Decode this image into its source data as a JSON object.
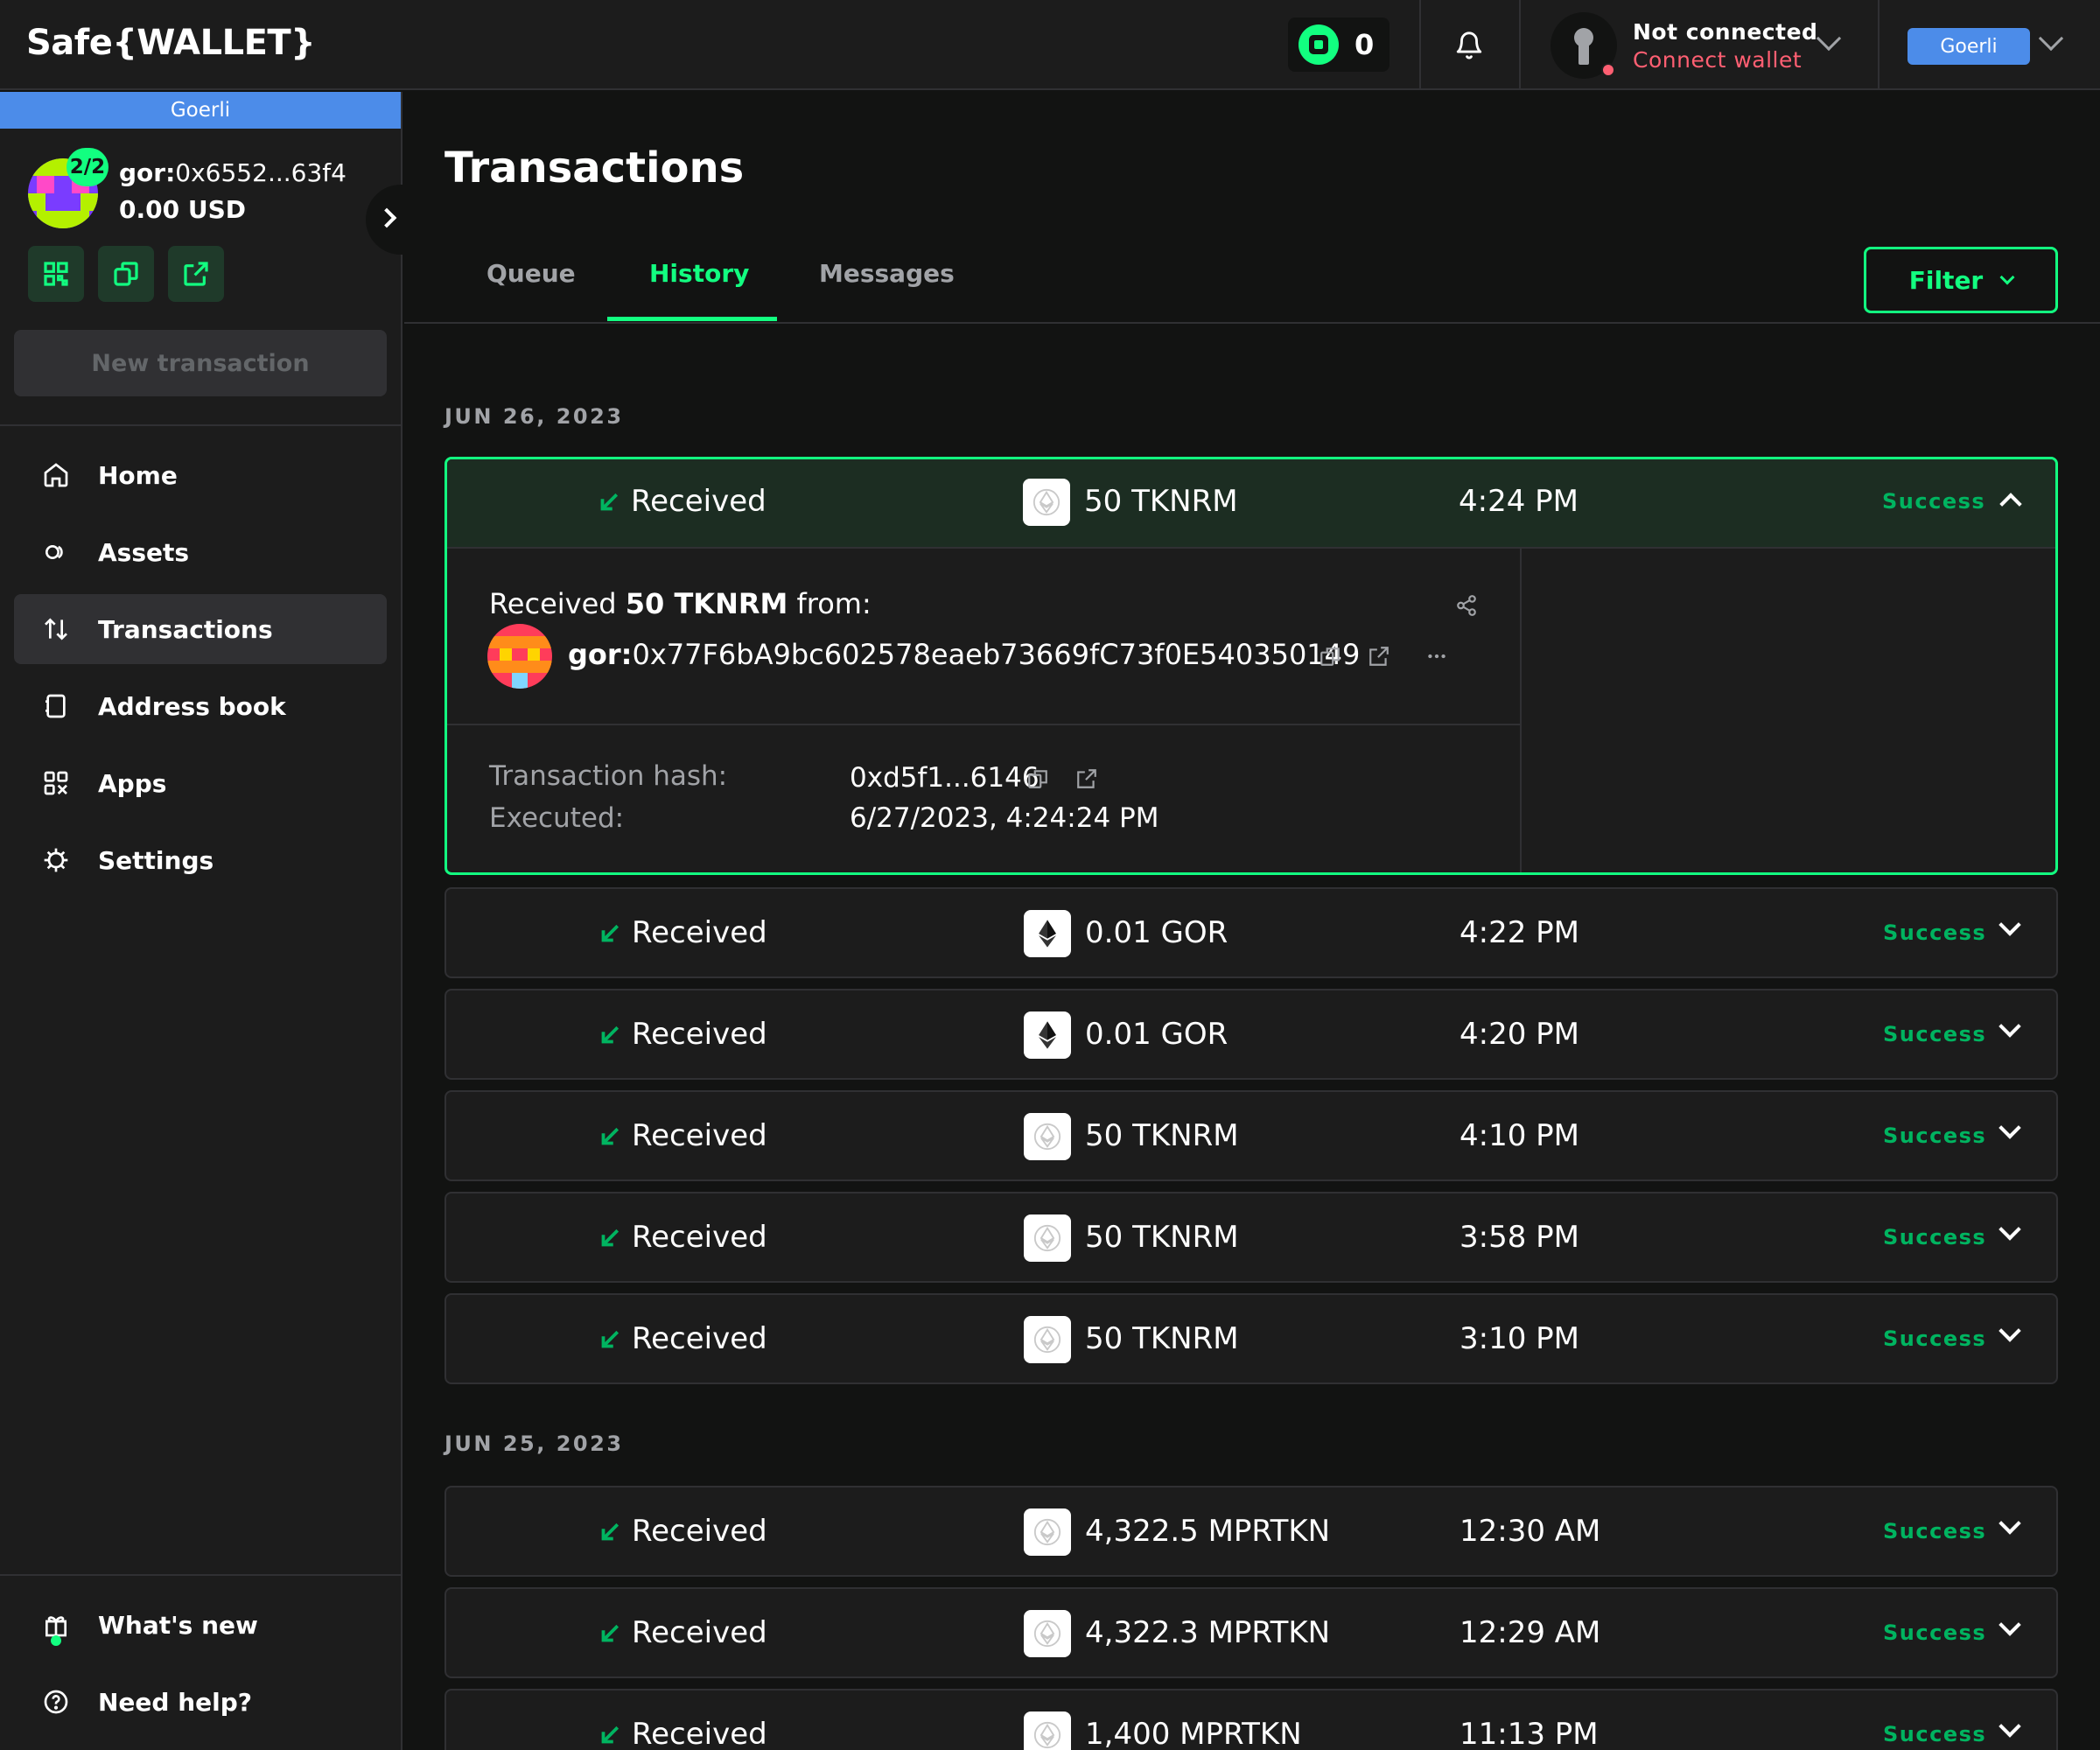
{
  "header": {
    "logo": "Safe{WALLET}",
    "pending_count": "0",
    "wallet_status": "Not connected",
    "connect_label": "Connect wallet",
    "network": "Goerli"
  },
  "sidebar": {
    "network_bar": "Goerli",
    "threshold": "2/2",
    "address_prefix": "gor:",
    "address": "0x6552...63f4",
    "balance": "0.00 USD",
    "new_transaction": "New transaction",
    "nav": [
      {
        "label": "Home",
        "icon": "home-icon"
      },
      {
        "label": "Assets",
        "icon": "assets-icon"
      },
      {
        "label": "Transactions",
        "icon": "transactions-icon"
      },
      {
        "label": "Address book",
        "icon": "address-book-icon"
      },
      {
        "label": "Apps",
        "icon": "apps-icon"
      },
      {
        "label": "Settings",
        "icon": "settings-icon"
      }
    ],
    "footer": [
      {
        "label": "What's new",
        "icon": "gift-icon"
      },
      {
        "label": "Need help?",
        "icon": "help-icon"
      }
    ]
  },
  "main": {
    "title": "Transactions",
    "tabs": [
      "Queue",
      "History",
      "Messages"
    ],
    "active_tab": "History",
    "filter_label": "Filter",
    "groups": [
      {
        "date": "JUN 26, 2023"
      },
      {
        "date": "JUN 25, 2023"
      }
    ],
    "expanded": {
      "type": "Received",
      "amount": "50 TKNRM",
      "time": "4:24 PM",
      "status": "Success",
      "received_prefix": "Received",
      "received_amount": "50 TKNRM",
      "received_suffix": "from:",
      "sender_prefix": "gor:",
      "sender_address": "0x77F6bA9bc602578eaeb73669fC73f0E540350149",
      "hash_label": "Transaction hash:",
      "hash_value": "0xd5f1...6146",
      "executed_label": "Executed:",
      "executed_value": "6/27/2023, 4:24:24 PM"
    },
    "transactions": [
      {
        "type": "Received",
        "amount": "0.01 GOR",
        "time": "4:22 PM",
        "status": "Success",
        "token": "eth"
      },
      {
        "type": "Received",
        "amount": "0.01 GOR",
        "time": "4:20 PM",
        "status": "Success",
        "token": "eth"
      },
      {
        "type": "Received",
        "amount": "50 TKNRM",
        "time": "4:10 PM",
        "status": "Success",
        "token": "generic"
      },
      {
        "type": "Received",
        "amount": "50 TKNRM",
        "time": "3:58 PM",
        "status": "Success",
        "token": "generic"
      },
      {
        "type": "Received",
        "amount": "50 TKNRM",
        "time": "3:10 PM",
        "status": "Success",
        "token": "generic"
      },
      {
        "type": "Received",
        "amount": "4,322.5 MPRTKN",
        "time": "12:30 AM",
        "status": "Success",
        "token": "generic"
      },
      {
        "type": "Received",
        "amount": "4,322.3 MPRTKN",
        "time": "12:29 AM",
        "status": "Success",
        "token": "generic"
      },
      {
        "type": "Received",
        "amount": "1,400 MPRTKN",
        "time": "11:13 PM",
        "status": "Success",
        "token": "generic"
      }
    ]
  },
  "colors": {
    "accent": "#12ff80",
    "success": "#00b460",
    "network": "#4c8ce9",
    "error": "#ff5f72"
  }
}
